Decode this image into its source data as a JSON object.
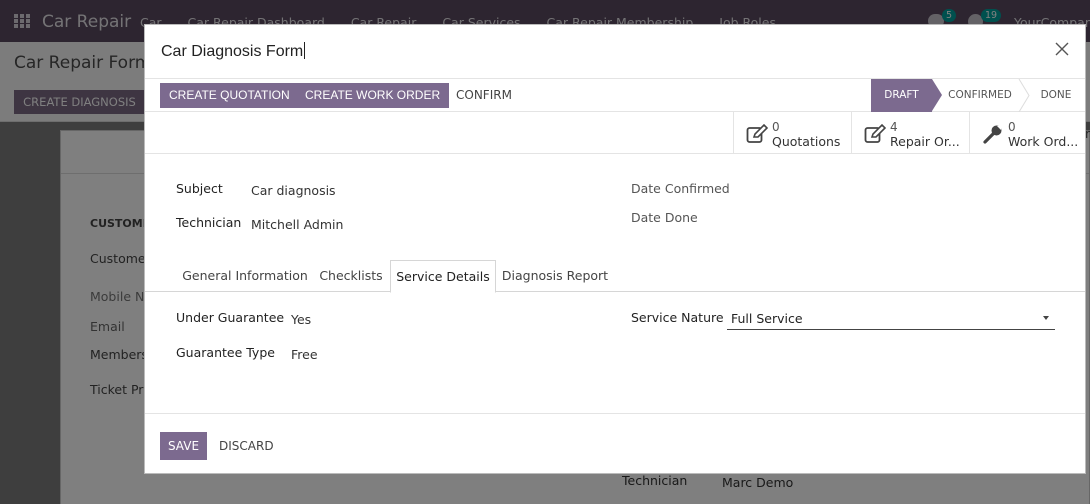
{
  "background": {
    "nav": {
      "app_name": "Car Repair",
      "menu_items": [
        "Car",
        "Car Repair Dashboard",
        "Car Repair",
        "Car Services",
        "Car Repair Membership",
        "Job Roles"
      ],
      "chat_badge": "5",
      "activity_badge": "19",
      "company": "YourCompany"
    },
    "breadcrumb": "Car Repair Form /",
    "create_diagnosis_label": "CREATE DIAGNOSIS",
    "labels": {
      "customer_section": "CUSTOMER",
      "customer": "Customer",
      "mobile": "Mobile N",
      "email": "Email",
      "membership": "Members",
      "ticket_price": "Ticket Pric",
      "technician": "Technician"
    },
    "technician_value": "Marc Demo",
    "cut_char": "r"
  },
  "modal": {
    "title": "Car Diagnosis Form",
    "buttons": {
      "create_quotation": "CREATE QUOTATION",
      "create_work_order": "CREATE WORK ORDER",
      "confirm": "CONFIRM"
    },
    "stages": [
      {
        "label": "DRAFT",
        "active": true
      },
      {
        "label": "CONFIRMED",
        "active": false
      },
      {
        "label": "DONE",
        "active": false
      }
    ],
    "stat_buttons": [
      {
        "count": "0",
        "label": "Quotations",
        "icon": "edit-icon"
      },
      {
        "count": "4",
        "label": "Repair Or...",
        "icon": "edit-icon"
      },
      {
        "count": "0",
        "label": "Work Ord...",
        "icon": "wrench-icon"
      }
    ],
    "fields": {
      "subject_label": "Subject",
      "subject_value": "Car diagnosis",
      "technician_label": "Technician",
      "technician_value": "Mitchell Admin",
      "date_confirmed_label": "Date Confirmed",
      "date_done_label": "Date Done"
    },
    "tabs": [
      {
        "label": "General Information",
        "active": false
      },
      {
        "label": "Checklists",
        "active": false
      },
      {
        "label": "Service Details",
        "active": true
      },
      {
        "label": "Diagnosis Report",
        "active": false
      }
    ],
    "service_details": {
      "under_guarantee_label": "Under Guarantee",
      "under_guarantee_value": "Yes",
      "guarantee_type_label": "Guarantee Type",
      "guarantee_type_value": "Free",
      "service_nature_label": "Service Nature",
      "service_nature_value": "Full Service"
    },
    "footer": {
      "save": "SAVE",
      "discard": "DISCARD"
    }
  },
  "colors": {
    "primary": "#7c6a8f",
    "navbar": "#5a4b61"
  }
}
